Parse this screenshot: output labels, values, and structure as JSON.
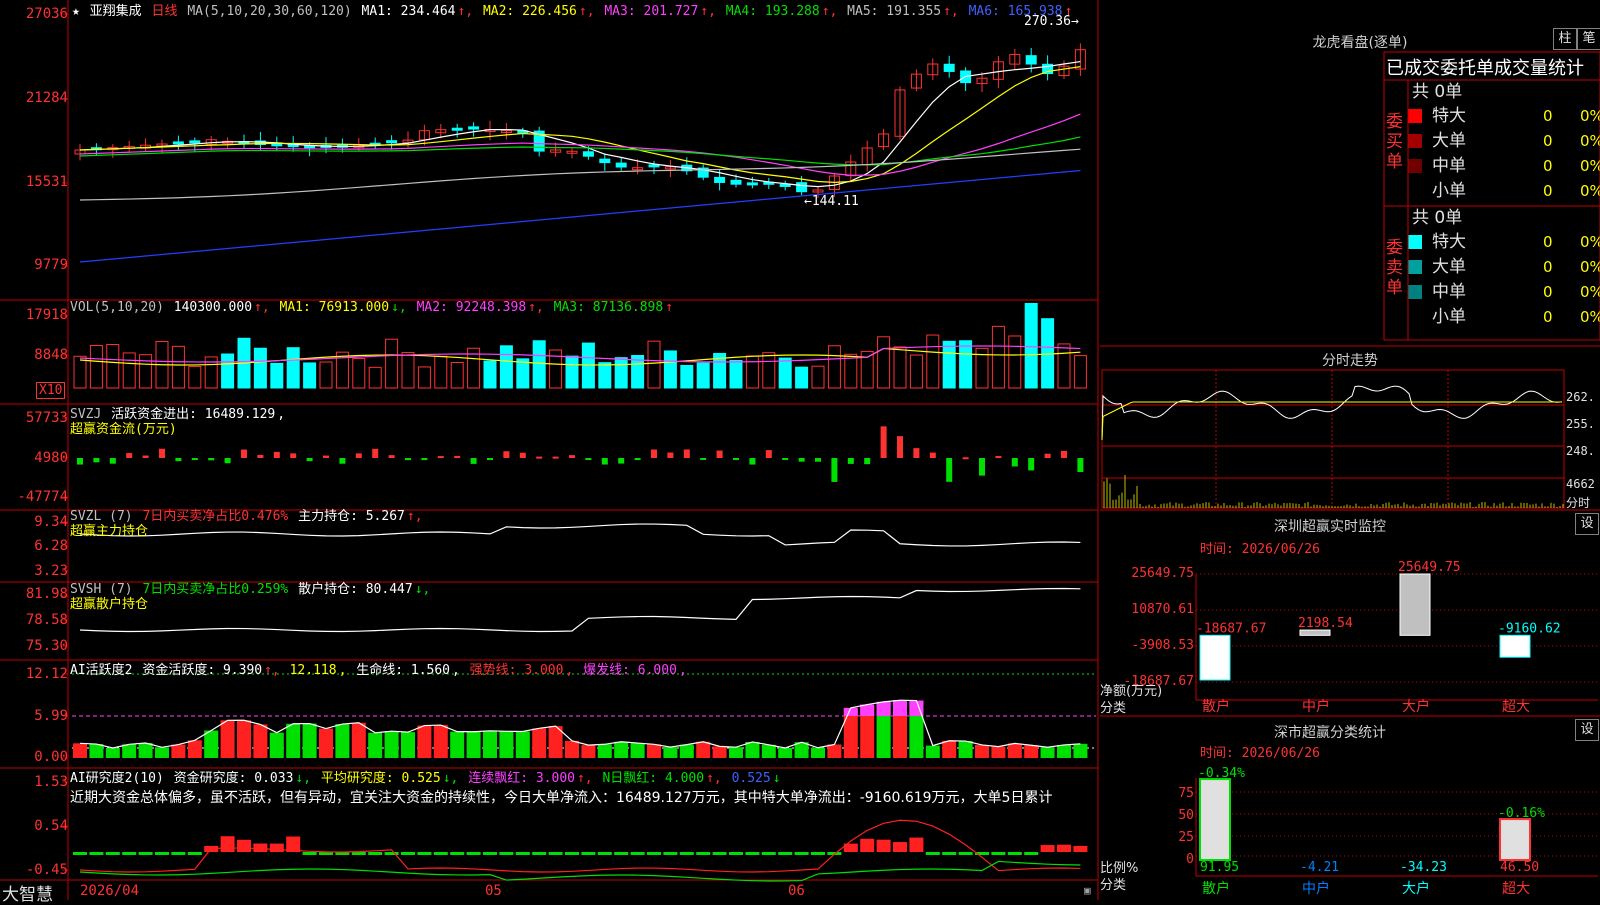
{
  "stock": {
    "name": "亚翔集成",
    "period": "日线",
    "star": "★",
    "ma_label": "MA(5,10,20,30,60,120)",
    "ma1": "MA1: 234.464",
    "ma2": "MA2: 226.456",
    "ma3": "MA3: 201.727",
    "ma4": "MA4: 193.288",
    "ma5": "MA5: 191.355",
    "ma6": "MA6: 165.938",
    "high_mark": "270.36",
    "low_mark": "144.11",
    "price_axis": [
      "27036",
      "21284",
      "15531",
      "9779"
    ]
  },
  "volume": {
    "label": "VOL(5,10,20)",
    "value": "140300.000",
    "ma1": "MA1: 76913.000",
    "ma2": "MA2: 92248.398",
    "ma3": "MA3: 87136.898",
    "axis": [
      "17918",
      "8848"
    ],
    "unit": "X10"
  },
  "svzj": {
    "label": "SVZJ",
    "line1": "活跃资金进出: 16489.129",
    "line2": "超赢资金流(万元)",
    "axis": [
      "57733",
      "4980",
      "-47774"
    ]
  },
  "svzl": {
    "label": "SVZL (7)",
    "ratio": "7日内买卖净占比0.476%",
    "hold": "主力持仓: 5.267",
    "line2": "超赢主力持仓",
    "axis": [
      "9.34",
      "6.28",
      "3.23"
    ]
  },
  "svsh": {
    "label": "SVSH (7)",
    "ratio": "7日内买卖净占比0.259%",
    "hold": "散户持仓: 80.447",
    "line2": "超赢散户持仓",
    "axis": [
      "81.98",
      "78.58",
      "75.30"
    ]
  },
  "ai_active": {
    "label": "AI活跃度2",
    "act": "资金活跃度: 9.390",
    "v2": "12.118",
    "life": "生命线: 1.560",
    "strong": "强势线: 3.000",
    "burst": "爆发线: 6.000",
    "axis": [
      "12.12",
      "5.99",
      "0.00"
    ]
  },
  "ai_research": {
    "label": "AI研究度2(10)",
    "res": "资金研究度: 0.033",
    "avg": "平均研究度: 0.525",
    "red": "连续飘红: 3.000",
    "nred": "N日飘红: 4.000",
    "v5": "0.525",
    "comment": "近期大资金总体偏多，虽不活跃，但有异动，宜关注大资金的持续性，今日大单净流入：16489.127万元，其中特大单净流出：-9160.619万元，大单5日累计",
    "axis": [
      "1.53",
      "0.54",
      "-0.45"
    ]
  },
  "bottom": {
    "brand": "大智慧",
    "date1": "2026/04",
    "date2": "05",
    "date3": "06"
  },
  "right": {
    "lh_title": "龙虎看盘(逐单)",
    "btn_bar": "柱",
    "btn_pen": "笔",
    "stat_title": "已成交委托单成交量统计",
    "buy_total": "共 0单",
    "buy_side": "委买单",
    "sell_total": "共 0单",
    "sell_side": "委卖单",
    "rows_buy": [
      {
        "name": "特大",
        "count": "0",
        "pct": "0%",
        "color": "#ff0000"
      },
      {
        "name": "大单",
        "count": "0",
        "pct": "0%",
        "color": "#a00000"
      },
      {
        "name": "中单",
        "count": "0",
        "pct": "0%",
        "color": "#700000"
      },
      {
        "name": "小单",
        "count": "0",
        "pct": "0%",
        "color": ""
      }
    ],
    "rows_sell": [
      {
        "name": "特大",
        "count": "0",
        "pct": "0%",
        "color": "#00ffff"
      },
      {
        "name": "大单",
        "count": "0",
        "pct": "0%",
        "color": "#00a0a0"
      },
      {
        "name": "中单",
        "count": "0",
        "pct": "0%",
        "color": "#008080"
      },
      {
        "name": "小单",
        "count": "0",
        "pct": "0%",
        "color": ""
      }
    ],
    "tick_title": "分时走势",
    "tick_axis": [
      "262.",
      "255.",
      "248.",
      "4662",
      "分时"
    ],
    "sz_title": "深圳超赢实时监控",
    "sz_gear": "设",
    "sz_time": "时间: 2026/06/26",
    "sz_axis": [
      "25649.75",
      "10870.61",
      "-3908.53",
      "-18687.67"
    ],
    "sz_unit1": "净额(万元)",
    "sz_unit2": "分类",
    "sz_cats": [
      "散户",
      "中户",
      "大户",
      "超大"
    ],
    "sz_values": [
      -18687.67,
      2198.54,
      25649.75,
      -9160.62
    ],
    "sz_labels": [
      "-18687.67",
      "2198.54",
      "25649.75",
      "-9160.62"
    ],
    "sc_title": "深市超赢分类统计",
    "sc_gear": "设",
    "sc_time": "时间: 2026/06/26",
    "sc_axis": [
      "75",
      "50",
      "25",
      "0"
    ],
    "sc_unit1": "比例%",
    "sc_unit2": "分类",
    "sc_cats": [
      "散户",
      "中户",
      "大户",
      "超大"
    ],
    "sc_top": [
      "-0.34%",
      "",
      "",
      "-0.16%"
    ],
    "sc_vals": [
      "91.95",
      "-4.21",
      "-34.23",
      "46.50"
    ],
    "sc_num": [
      91.95,
      -4.21,
      -34.23,
      46.5
    ]
  },
  "colors": {
    "up": "#ff3232",
    "down": "#00ffff",
    "grid": "#c00000",
    "ma1": "#ffffff",
    "ma2": "#ffff00",
    "ma3": "#ff40ff",
    "ma4": "#00e000",
    "ma5": "#c0c0c0",
    "ma6": "#2040ff"
  }
}
